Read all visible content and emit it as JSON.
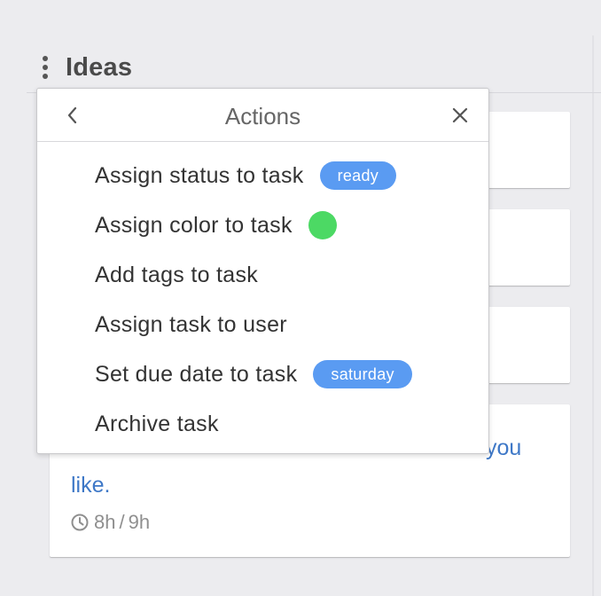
{
  "column": {
    "title": "Ideas"
  },
  "cards": [
    {
      "text_line1": "",
      "text_line2": ""
    },
    {
      "text_line1": "",
      "text_line2": ""
    },
    {
      "text_line1": "",
      "text_line2": ""
    },
    {
      "text_line1_visible": "you",
      "text_line2": "like.",
      "time_spent": "8h",
      "time_estimate": "9h",
      "time_separator": "/"
    }
  ],
  "popup": {
    "title": "Actions",
    "back_icon": "chevron-left-icon",
    "close_icon": "close-icon",
    "items": [
      {
        "label": "Assign status to task",
        "badge": "ready",
        "badge_color": "#5a9bf2"
      },
      {
        "label": "Assign color to task",
        "color_dot": "#4cd964"
      },
      {
        "label": "Add tags to task"
      },
      {
        "label": "Assign task to user"
      },
      {
        "label": "Set due date to task",
        "badge": "saturday",
        "badge_color": "#5a9bf2"
      },
      {
        "label": "Archive task"
      }
    ]
  },
  "colors": {
    "background": "#ececef",
    "link_text": "#3e78c7",
    "badge_blue": "#5a9bf2",
    "status_green": "#4cd964"
  }
}
